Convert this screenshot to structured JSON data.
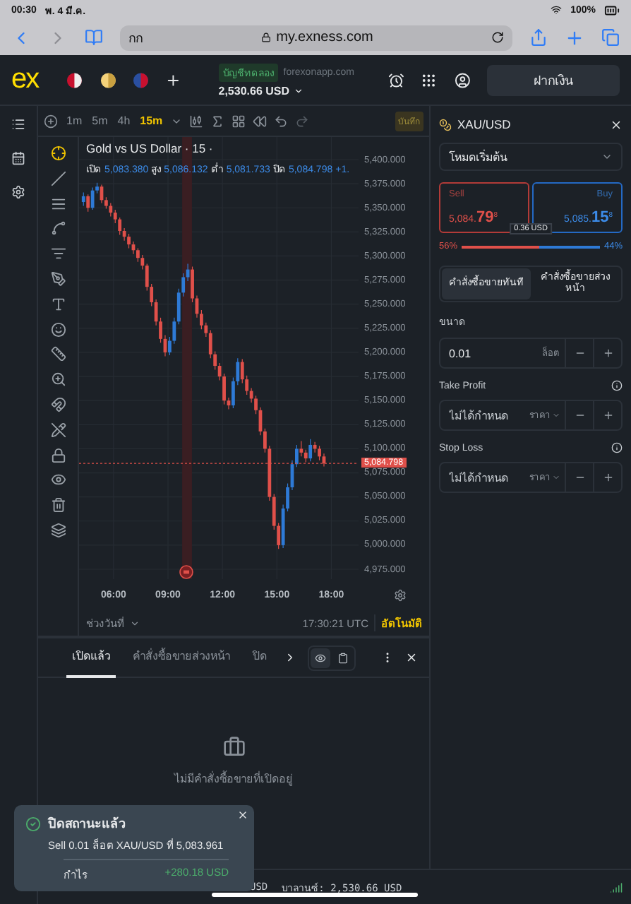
{
  "status_bar": {
    "time": "00:30",
    "date": "พ. 4 มี.ค.",
    "battery": "100%"
  },
  "browser": {
    "tab_text": "กก",
    "url": "my.exness.com"
  },
  "header": {
    "logo": "ex",
    "account_tag": "บัญชีทดลอง",
    "server": "forexonapp.com",
    "balance": "2,530.66 USD",
    "deposit_button": "ฝากเงิน"
  },
  "chart_toolbar": {
    "timeframes": [
      {
        "label": "1m",
        "selected": false
      },
      {
        "label": "5m",
        "selected": false
      },
      {
        "label": "4h",
        "selected": false
      },
      {
        "label": "15m",
        "selected": true
      }
    ],
    "save_label": "บันทึก"
  },
  "chart": {
    "title": "Gold vs US Dollar · 15 ·",
    "ohlc": [
      {
        "label": "เปิด",
        "value": "5,083.380"
      },
      {
        "label": "สูง",
        "value": "5,086.132"
      },
      {
        "label": "ต่ำ",
        "value": "5,081.733"
      },
      {
        "label": "ปิด",
        "value": "5,084.798"
      }
    ],
    "change": "+1.",
    "current_price": "5,084.798",
    "chart_data": {
      "type": "candlestick",
      "ylim": [
        4975,
        5400
      ],
      "yticks": [
        {
          "value": 5400,
          "label": "5,400.000"
        },
        {
          "value": 5375,
          "label": "5,375.000"
        },
        {
          "value": 5350,
          "label": "5,350.000"
        },
        {
          "value": 5325,
          "label": "5,325.000"
        },
        {
          "value": 5300,
          "label": "5,300.000"
        },
        {
          "value": 5275,
          "label": "5,275.000"
        },
        {
          "value": 5250,
          "label": "5,250.000"
        },
        {
          "value": 5225,
          "label": "5,225.000"
        },
        {
          "value": 5200,
          "label": "5,200.000"
        },
        {
          "value": 5175,
          "label": "5,175.000"
        },
        {
          "value": 5150,
          "label": "5,150.000"
        },
        {
          "value": 5125,
          "label": "5,125.000"
        },
        {
          "value": 5100,
          "label": "5,100.000"
        },
        {
          "value": 5075,
          "label": "5,075.000"
        },
        {
          "value": 5050,
          "label": "5,050.000"
        },
        {
          "value": 5025,
          "label": "5,025.000"
        },
        {
          "value": 5000,
          "label": "5,000.000"
        },
        {
          "value": 4975,
          "label": "4,975.000"
        }
      ],
      "x": [
        4.25,
        4.5,
        4.75,
        5,
        5.25,
        5.5,
        5.75,
        6,
        6.25,
        6.5,
        6.75,
        7,
        7.25,
        7.5,
        7.75,
        8,
        8.25,
        8.5,
        8.75,
        9,
        9.25,
        9.5,
        9.75,
        10,
        10.25,
        10.5,
        10.75,
        11,
        11.25,
        11.5,
        11.75,
        12,
        12.25,
        12.5,
        12.75,
        13,
        13.25,
        13.5,
        13.75,
        14,
        14.25,
        14.5,
        14.75,
        15,
        15.25,
        15.5,
        15.75,
        16,
        16.25,
        16.5,
        16.75,
        17,
        17.25,
        17.5
      ],
      "xlim": [
        4.1,
        19.5
      ],
      "grid": true,
      "bands": [
        {
          "axis": "x",
          "from": 9.78,
          "to": 10.32
        }
      ],
      "ref_lines": [
        {
          "axis": "y",
          "value": 5084.798
        }
      ],
      "xticks": [
        {
          "value": 6,
          "label": "06:00"
        },
        {
          "value": 9,
          "label": "09:00"
        },
        {
          "value": 12,
          "label": "12:00"
        },
        {
          "value": 15,
          "label": "15:00"
        },
        {
          "value": 18,
          "label": "18:00"
        }
      ],
      "ohlc": [
        [
          5356,
          5366,
          5352,
          5362
        ],
        [
          5362,
          5364,
          5346,
          5350
        ],
        [
          5350,
          5371,
          5348,
          5368
        ],
        [
          5368,
          5376,
          5365,
          5372
        ],
        [
          5372,
          5374,
          5355,
          5358
        ],
        [
          5358,
          5361,
          5349,
          5352
        ],
        [
          5352,
          5355,
          5341,
          5345
        ],
        [
          5345,
          5348,
          5334,
          5338
        ],
        [
          5338,
          5340,
          5322,
          5326
        ],
        [
          5326,
          5329,
          5316,
          5320
        ],
        [
          5320,
          5323,
          5308,
          5312
        ],
        [
          5312,
          5315,
          5302,
          5306
        ],
        [
          5306,
          5308,
          5294,
          5298
        ],
        [
          5298,
          5301,
          5286,
          5290
        ],
        [
          5290,
          5292,
          5264,
          5268
        ],
        [
          5268,
          5271,
          5248,
          5252
        ],
        [
          5252,
          5255,
          5228,
          5232
        ],
        [
          5232,
          5236,
          5210,
          5214
        ],
        [
          5214,
          5218,
          5196,
          5200
        ],
        [
          5200,
          5216,
          5197,
          5212
        ],
        [
          5212,
          5236,
          5209,
          5232
        ],
        [
          5232,
          5266,
          5229,
          5262
        ],
        [
          5262,
          5282,
          5258,
          5278
        ],
        [
          5278,
          5292,
          5274,
          5286
        ],
        [
          5286,
          5289,
          5252,
          5256
        ],
        [
          5256,
          5259,
          5236,
          5240
        ],
        [
          5240,
          5244,
          5224,
          5228
        ],
        [
          5228,
          5231,
          5216,
          5220
        ],
        [
          5220,
          5223,
          5194,
          5198
        ],
        [
          5198,
          5201,
          5182,
          5186
        ],
        [
          5186,
          5189,
          5171,
          5175
        ],
        [
          5175,
          5178,
          5146,
          5150
        ],
        [
          5150,
          5153,
          5141,
          5145
        ],
        [
          5145,
          5174,
          5142,
          5170
        ],
        [
          5170,
          5194,
          5166,
          5190
        ],
        [
          5190,
          5193,
          5168,
          5172
        ],
        [
          5172,
          5176,
          5156,
          5160
        ],
        [
          5160,
          5163,
          5148,
          5152
        ],
        [
          5152,
          5155,
          5136,
          5140
        ],
        [
          5140,
          5143,
          5114,
          5118
        ],
        [
          5118,
          5121,
          5096,
          5100
        ],
        [
          5100,
          5103,
          5046,
          5050
        ],
        [
          5050,
          5053,
          5016,
          5020
        ],
        [
          5020,
          5023,
          4996,
          5000
        ],
        [
          5000,
          5042,
          4997,
          5038
        ],
        [
          5038,
          5064,
          5035,
          5060
        ],
        [
          5060,
          5088,
          5057,
          5084
        ],
        [
          5084,
          5104,
          5081,
          5100
        ],
        [
          5100,
          5108,
          5092,
          5096
        ],
        [
          5096,
          5099,
          5086,
          5090
        ],
        [
          5090,
          5110,
          5087,
          5104
        ],
        [
          5104,
          5107,
          5096,
          5100
        ],
        [
          5100,
          5103,
          5088,
          5092
        ],
        [
          5092,
          5095,
          5081.7,
          5084.8
        ]
      ]
    },
    "date_range": "ช่วงวันที่",
    "clock": "17:30:21 UTC",
    "auto_label": "อัตโนมัติ"
  },
  "bottom_panel": {
    "tabs": [
      {
        "label": "เปิดแล้ว",
        "selected": true
      },
      {
        "label": "คำสั่งซื้อขายส่วงหน้า",
        "selected": false
      },
      {
        "label": "ปิด",
        "selected": false
      }
    ],
    "empty_message": "ไม่มีคำสั่งซื้อขายที่เปิดอยู่"
  },
  "footer": {
    "equity_tail": "USD",
    "balance": "บาลานซ์: 2,530.66 USD"
  },
  "order_panel": {
    "symbol": "XAU/USD",
    "mode": "โหมดเริ่มต้น",
    "sell": {
      "label": "Sell",
      "price": "5,084.**79**$^{8}$"
    },
    "buy": {
      "label": "Buy",
      "price": "5,085.**15**$^{8}$"
    },
    "spread": "0.36 USD",
    "sentiment": {
      "sell_pct": "56%",
      "buy_pct": "44%",
      "level": 0.56
    },
    "order_types": [
      {
        "label": "คำสั่งซื้อขายทันที",
        "selected": true
      },
      {
        "label": "คำสั่งซื้อขายส่วงหน้า",
        "selected": false
      }
    ],
    "size": {
      "label": "ขนาด",
      "value": "0.01",
      "unit": "ล็อต"
    },
    "take_profit": {
      "label": "Take Profit",
      "placeholder": "ไม่ได้กำหนด",
      "mode": "ราคา"
    },
    "stop_loss": {
      "label": "Stop Loss",
      "placeholder": "ไม่ได้กำหนด",
      "mode": "ราคา"
    }
  },
  "toast": {
    "title": "ปิดสถานะแล้ว",
    "message": "Sell 0.01 ล็อต XAU/USD ที่ 5,083.961",
    "profit_label": "กำไร",
    "profit": "+280.18 USD"
  }
}
